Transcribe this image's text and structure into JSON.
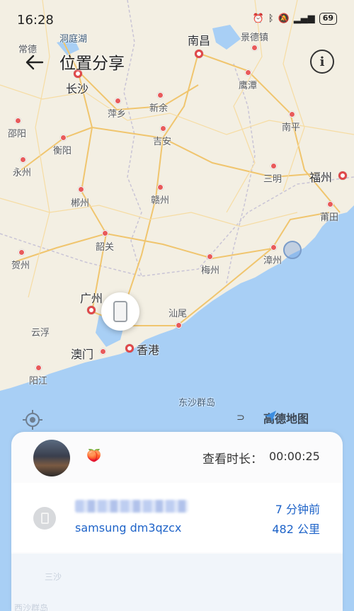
{
  "status_bar": {
    "time": "16:28",
    "battery": "69",
    "icons": [
      "alarm-icon",
      "bluetooth-icon",
      "mute-icon",
      "vibrate-icon",
      "signal-icon"
    ]
  },
  "header": {
    "title": "位置分享",
    "back_icon": "arrow-left-icon",
    "info_icon": "info-icon"
  },
  "map": {
    "provider": "高德地图",
    "colors": {
      "land": "#f3efe3",
      "sea": "#a8cff5",
      "road": "#f0c56e",
      "capital_dot": "#e0484a"
    },
    "major_cities": [
      "南昌",
      "长沙",
      "福州",
      "广州",
      "香港"
    ],
    "cities": [
      "常德",
      "洞庭湖",
      "景德镇",
      "萍乡",
      "新余",
      "鹰潭",
      "邵阳",
      "衡阳",
      "吉安",
      "南平",
      "永州",
      "三明",
      "郴州",
      "赣州",
      "莆田",
      "韶关",
      "贺州",
      "漳州",
      "梅州",
      "汕尾",
      "云浮",
      "澳门",
      "阳江",
      "东沙群岛",
      "福州"
    ]
  },
  "card": {
    "emoji": "🍑",
    "view_label": "查看时长：",
    "view_time": "00:00:25",
    "device": {
      "name": "samsung dm3qzcx",
      "elapsed": "7 分钟前",
      "distance": "482 公里"
    },
    "ghost_labels": [
      "三沙",
      "西沙群岛"
    ]
  }
}
